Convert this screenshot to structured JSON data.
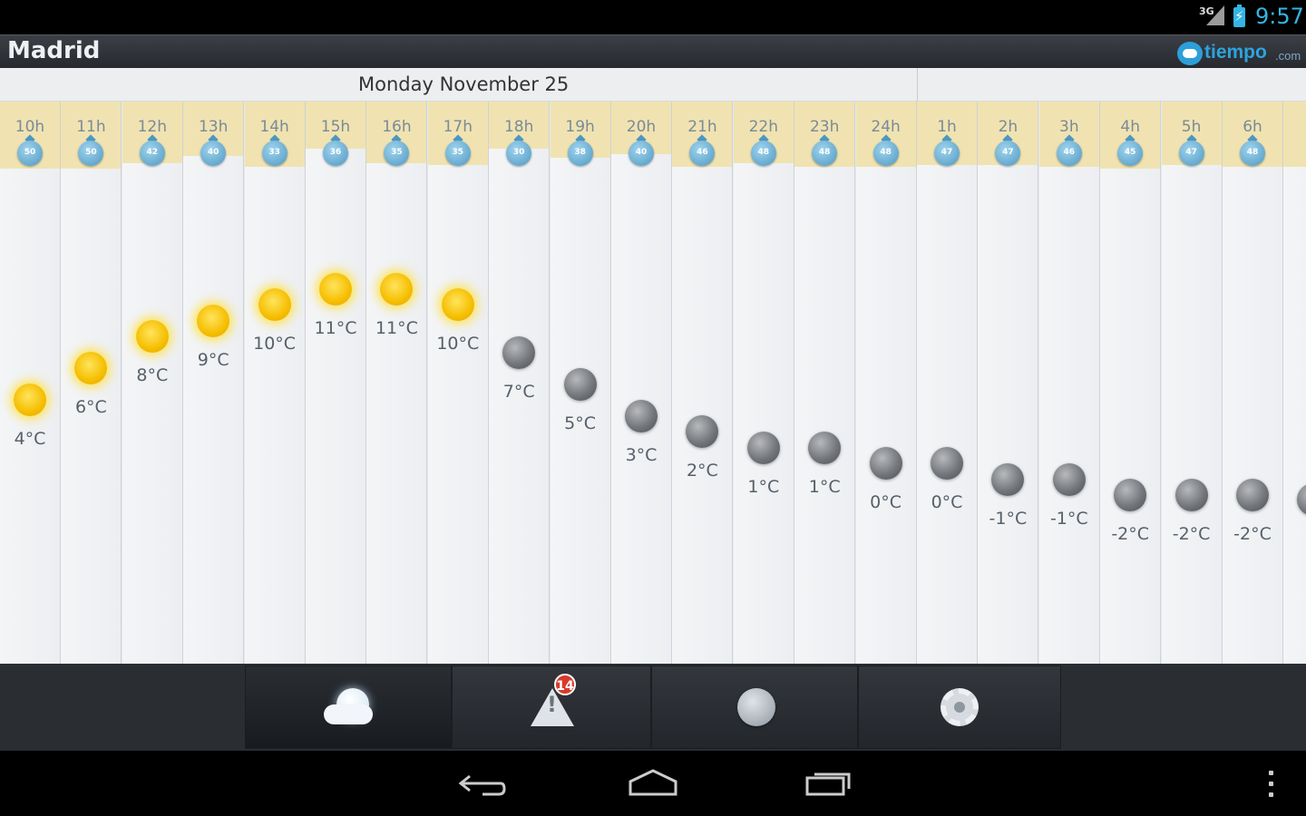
{
  "status_bar": {
    "network": "3G",
    "time": "9:57"
  },
  "header": {
    "city": "Madrid",
    "logo_brand": "tiempo",
    "logo_tld": ".com"
  },
  "date_bar": {
    "date": "Monday November 25"
  },
  "forecast": [
    {
      "hour": "10h",
      "wind": "50",
      "icon": "sun-icon",
      "temp": "4°C",
      "temp_value": 4
    },
    {
      "hour": "11h",
      "wind": "50",
      "icon": "sun-icon",
      "temp": "6°C",
      "temp_value": 6
    },
    {
      "hour": "12h",
      "wind": "42",
      "icon": "sun-icon",
      "temp": "8°C",
      "temp_value": 8
    },
    {
      "hour": "13h",
      "wind": "40",
      "icon": "sun-icon",
      "temp": "9°C",
      "temp_value": 9
    },
    {
      "hour": "14h",
      "wind": "33",
      "icon": "sun-icon",
      "temp": "10°C",
      "temp_value": 10
    },
    {
      "hour": "15h",
      "wind": "36",
      "icon": "sun-icon",
      "temp": "11°C",
      "temp_value": 11
    },
    {
      "hour": "16h",
      "wind": "35",
      "icon": "sun-icon",
      "temp": "11°C",
      "temp_value": 11
    },
    {
      "hour": "17h",
      "wind": "35",
      "icon": "sun-icon",
      "temp": "10°C",
      "temp_value": 10
    },
    {
      "hour": "18h",
      "wind": "30",
      "icon": "moon-icon",
      "temp": "7°C",
      "temp_value": 7
    },
    {
      "hour": "19h",
      "wind": "38",
      "icon": "moon-icon",
      "temp": "5°C",
      "temp_value": 5
    },
    {
      "hour": "20h",
      "wind": "40",
      "icon": "moon-icon",
      "temp": "3°C",
      "temp_value": 3
    },
    {
      "hour": "21h",
      "wind": "46",
      "icon": "moon-icon",
      "temp": "2°C",
      "temp_value": 2
    },
    {
      "hour": "22h",
      "wind": "48",
      "icon": "moon-icon",
      "temp": "1°C",
      "temp_value": 1
    },
    {
      "hour": "23h",
      "wind": "48",
      "icon": "moon-icon",
      "temp": "1°C",
      "temp_value": 1
    },
    {
      "hour": "24h",
      "wind": "48",
      "icon": "moon-icon",
      "temp": "0°C",
      "temp_value": 0
    },
    {
      "hour": "1h",
      "wind": "47",
      "icon": "moon-icon",
      "temp": "0°C",
      "temp_value": 0
    },
    {
      "hour": "2h",
      "wind": "47",
      "icon": "moon-icon",
      "temp": "-1°C",
      "temp_value": -1
    },
    {
      "hour": "3h",
      "wind": "46",
      "icon": "moon-icon",
      "temp": "-1°C",
      "temp_value": -1
    },
    {
      "hour": "4h",
      "wind": "45",
      "icon": "moon-icon",
      "temp": "-2°C",
      "temp_value": -2
    },
    {
      "hour": "5h",
      "wind": "47",
      "icon": "moon-icon",
      "temp": "-2°C",
      "temp_value": -2
    },
    {
      "hour": "6h",
      "wind": "48",
      "icon": "moon-icon",
      "temp": "-2°C",
      "temp_value": -2
    },
    {
      "hour": "",
      "wind": "",
      "icon": "moon-icon",
      "temp": "-",
      "temp_value": -2.3
    }
  ],
  "tabs": [
    {
      "name": "weather",
      "icon": "cloud-icon"
    },
    {
      "name": "alerts",
      "icon": "warning-icon",
      "badge": "14"
    },
    {
      "name": "map",
      "icon": "globe-icon"
    },
    {
      "name": "settings",
      "icon": "gear-icon"
    }
  ],
  "nav": {
    "back": "back-icon",
    "home": "home-icon",
    "recents": "recents-icon",
    "menu": "overflow-menu-icon"
  },
  "colors": {
    "accent": "#33b5e5",
    "sun": "#f5be00",
    "wind_band": "#f0e3b1",
    "badge": "#d83a2b",
    "brand": "#2da3de"
  }
}
